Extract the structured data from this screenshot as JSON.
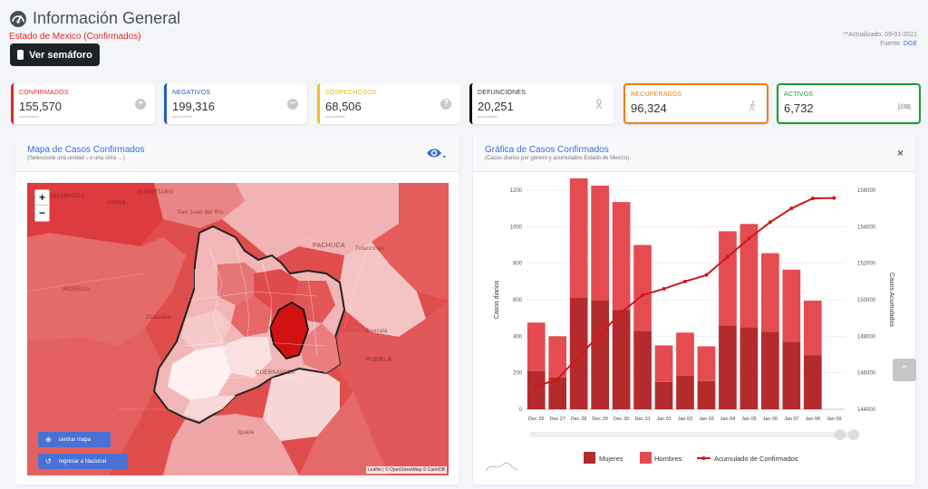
{
  "header": {
    "title": "Información General",
    "subtitle": "Estado de Mexico (Confirmados)",
    "semaforo_label": "Ver semáforo",
    "updated": "**Actualizado: 09-01-2021",
    "source_label": "Fuente:",
    "source_value": "DGE"
  },
  "stats": [
    {
      "label": "CONFIRMADOS",
      "value": "155,570",
      "sub": "acumulados",
      "color": "#e02a2a",
      "icon": "plus-circle-icon"
    },
    {
      "label": "NEGATIVOS",
      "value": "199,316",
      "sub": "acumulados",
      "color": "#1f5fb8",
      "icon": "minus-circle-icon"
    },
    {
      "label": "SOSPECHOSOS",
      "value": "68,506",
      "sub": "acumulados",
      "color": "#f0c419",
      "icon": "question-circle-icon"
    },
    {
      "label": "DEFUNCIONES",
      "value": "20,251",
      "sub": "acumulados",
      "color": "#111111",
      "icon": "ribbon-icon"
    },
    {
      "label": "RECUPERADOS",
      "value": "96,324",
      "sub": "",
      "color": "#f07e14",
      "icon": "walking-person-icon"
    },
    {
      "label": "ACTIVOS",
      "value": "6,732",
      "sub": "",
      "color": "#1a9b3b",
      "icon": "bed-icon"
    }
  ],
  "map_card": {
    "title": "Mapa de Casos Confirmados",
    "subtitle": "(Seleccione una unidad ↓ o una vista →)",
    "zoom_in": "+",
    "zoom_out": "−",
    "center_button": "centrar mapa",
    "back_button": "regresar a Nacional",
    "attribution": "Leaflet | © OpenStreetMap © CartoDB",
    "place_labels": [
      "SALAMANCA",
      "QUERÉTARO",
      "Celaya",
      "San Juan del Río",
      "PACHUCA",
      "Tulancingo",
      "MORELIA",
      "Zitácuaro",
      "Tlaxcala",
      "PUEBLA",
      "CUERNAVACA",
      "Iguala"
    ]
  },
  "chart_card": {
    "title": "Gráfica de Casos Confirmados",
    "subtitle": "(Casos diarios por género y acumulados Estado de Mexico)",
    "close": "×"
  },
  "chart_data": {
    "type": "bar",
    "categories": [
      "Dec 26",
      "Dec 27",
      "Dec 28",
      "Dec 29",
      "Dec 30",
      "Dec 31",
      "Jan 01",
      "Jan 02",
      "Jan 03",
      "Jan 04",
      "Jan 05",
      "Jan 06",
      "Jan 07",
      "Jan 08",
      "Jan 09"
    ],
    "series": [
      {
        "name": "Mujeres",
        "type": "bar",
        "stack": "genero",
        "axis": "left",
        "color": "#b52a2d",
        "values": [
          210,
          175,
          610,
          595,
          545,
          430,
          150,
          185,
          155,
          460,
          450,
          425,
          370,
          295,
          0
        ]
      },
      {
        "name": "Hombres",
        "type": "bar",
        "stack": "genero",
        "axis": "left",
        "color": "#e54c52",
        "values": [
          265,
          225,
          655,
          630,
          590,
          470,
          200,
          235,
          190,
          515,
          565,
          430,
          395,
          300,
          0
        ]
      },
      {
        "name": "Acumulado de Confirmados",
        "type": "line",
        "axis": "right",
        "color": "#d01818",
        "values": [
          145250,
          145650,
          146900,
          148100,
          149300,
          150250,
          150600,
          151000,
          151350,
          152350,
          153350,
          154250,
          155000,
          155550,
          155570
        ]
      }
    ],
    "ylabel": "Casos diarios",
    "y2label": "Casos Acumulados",
    "ylim": [
      0,
      1200
    ],
    "yticks": [
      0,
      200,
      400,
      600,
      800,
      1000,
      1200
    ],
    "y2lim": [
      144000,
      156000
    ],
    "y2ticks": [
      144000,
      146000,
      148000,
      150000,
      152000,
      154000,
      156000
    ],
    "grid": true,
    "legend_position": "bottom"
  }
}
